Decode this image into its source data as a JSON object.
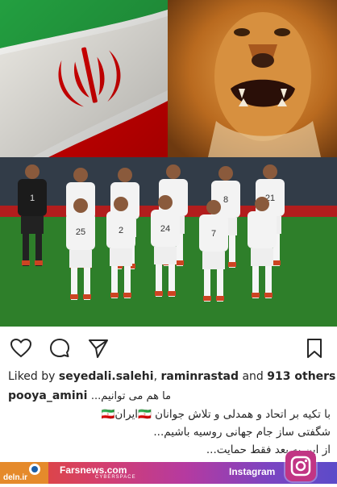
{
  "post": {
    "liked_by_prefix": "Liked by ",
    "liker1": "seyedali.salehi",
    "sep": ", ",
    "liker2": "raminrastad",
    "and_text": " and ",
    "others_count": "913 others",
    "username": "pooya_amini",
    "caption_line1": "...ما هم می توانیم",
    "caption_line2": "با تکیه بر اتحاد و همدلی و تلاش جوانان 🇮🇷ایران🇮🇷",
    "caption_line3": "شگفتی ساز جام جهانی روسیه باشیم...",
    "caption_line4": "از این به بعد فقط حمایت..."
  },
  "team_jerseys": [
    "1",
    "2",
    "24",
    "8",
    "25",
    "21",
    "7"
  ],
  "footer": {
    "brand_text": "deln.ir",
    "site": "Farsnews.com",
    "site_sub": "CYBERSPACE",
    "platform": "Instagram"
  },
  "colors": {
    "flag_green": "#239f40",
    "flag_red": "#da0000",
    "lion": "#b66f22",
    "jersey": "#f3f3f3",
    "keeper": "#1b1b1b"
  },
  "icons": [
    "heart-icon",
    "comment-icon",
    "share-icon",
    "bookmark-icon",
    "instagram-icon"
  ]
}
